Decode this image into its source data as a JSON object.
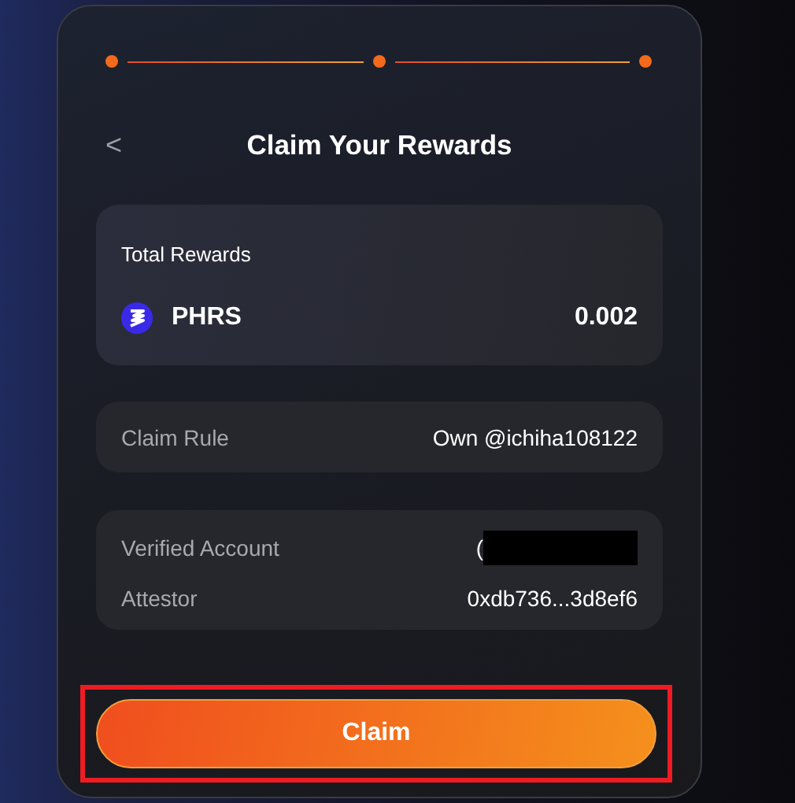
{
  "steps": [
    {
      "done": true
    },
    {
      "done": true
    },
    {
      "done": true
    }
  ],
  "header": {
    "back": "<",
    "title": "Claim Your Rewards"
  },
  "rewards": {
    "label": "Total Rewards",
    "token": "PHRS",
    "amount": "0.002"
  },
  "rule": {
    "label": "Claim Rule",
    "value": "Own @ichiha108122"
  },
  "details": [
    {
      "label": "Verified Account",
      "value": "(",
      "redacted": true
    },
    {
      "label": "Attestor",
      "value": "0xdb736...3d8ef6",
      "redacted": false
    }
  ],
  "claim_button": {
    "label": "Claim",
    "highlighted": true
  }
}
